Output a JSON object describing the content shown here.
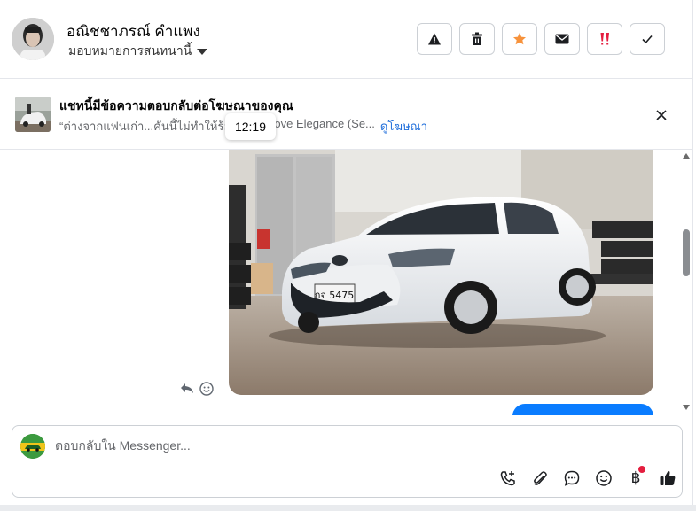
{
  "header": {
    "contact_name": "อณิชชาภรณ์ คำแพง",
    "assign_label": "มอบหมายการสนทนานี้",
    "actions": [
      {
        "name": "report-button",
        "icon": "warning-triangle-icon"
      },
      {
        "name": "delete-button",
        "icon": "trash-icon"
      },
      {
        "name": "star-button",
        "icon": "star-icon",
        "color": "#f7923b"
      },
      {
        "name": "mark-unread-button",
        "icon": "envelope-icon"
      },
      {
        "name": "important-button",
        "icon": "double-exclamation-icon",
        "color": "#e41e3f"
      },
      {
        "name": "mark-done-button",
        "icon": "checkmark-icon"
      }
    ]
  },
  "ad_banner": {
    "title": "แชทนี้มีข้อความตอบกลับต่อโฆษณาของคุณ",
    "subtitle": "“ต่างจากแฟนเก่า...คันนี้ไม่ทำให้ร้องไห้",
    "ad_name": "Groove Elegance (Se...",
    "link_label": "ดูโฆษณา",
    "tooltip_time": "12:19"
  },
  "chat": {
    "photo_plate": "กจ 5475"
  },
  "composer": {
    "placeholder": "ตอบกลับใน Messenger...",
    "tools": [
      "call-add-icon",
      "paperclip-icon",
      "chat-bubble-icon",
      "emoji-icon",
      "baht-icon",
      "thumbs-up-icon"
    ],
    "baht_symbol": "฿"
  },
  "colors": {
    "accent_blue": "#0a7cff",
    "link_blue": "#216fdb",
    "star_orange": "#f7923b",
    "alert_red": "#e41e3f"
  }
}
